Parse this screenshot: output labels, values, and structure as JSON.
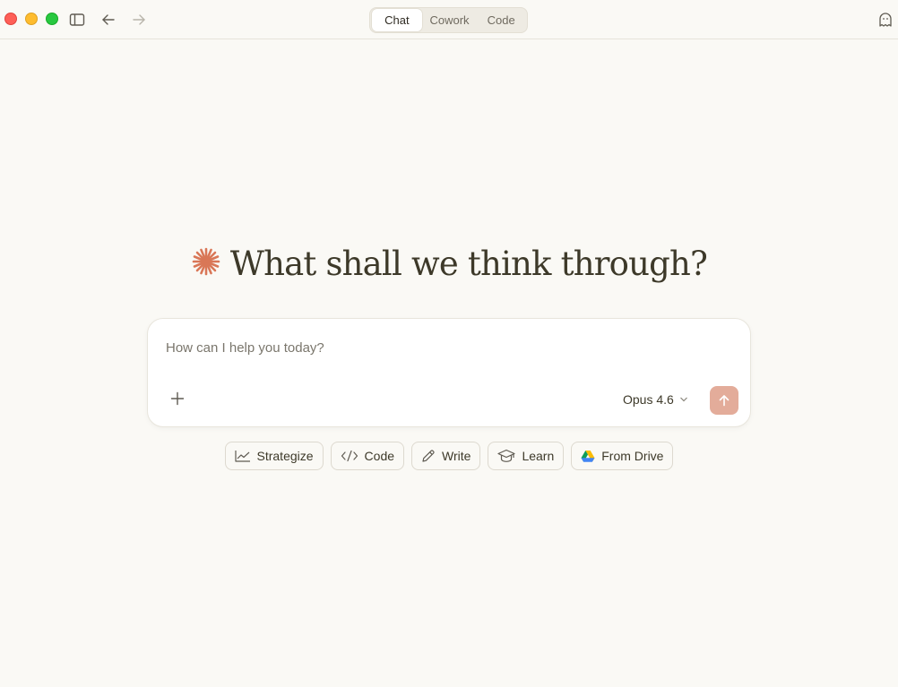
{
  "titlebar": {
    "tabs": [
      {
        "label": "Chat",
        "active": true
      },
      {
        "label": "Cowork",
        "active": false
      },
      {
        "label": "Code",
        "active": false
      }
    ],
    "icons": {
      "sidebar": "sidebar-toggle-icon",
      "back": "arrow-left-icon",
      "forward": "arrow-right-icon",
      "ghost": "ghost-icon"
    }
  },
  "main": {
    "heading": "What shall we think through?",
    "logo": "asterisk-logo-icon"
  },
  "composer": {
    "placeholder": "How can I help you today?",
    "value": "",
    "model": "Opus 4.6"
  },
  "chips": [
    {
      "label": "Strategize",
      "icon": "chart-line-icon"
    },
    {
      "label": "Code",
      "icon": "code-icon"
    },
    {
      "label": "Write",
      "icon": "pencil-icon"
    },
    {
      "label": "Learn",
      "icon": "graduation-cap-icon"
    },
    {
      "label": "From Drive",
      "icon": "google-drive-icon"
    }
  ],
  "colors": {
    "background": "#faf9f5",
    "accent": "#d97757",
    "send_button": "#e3ac9a"
  }
}
